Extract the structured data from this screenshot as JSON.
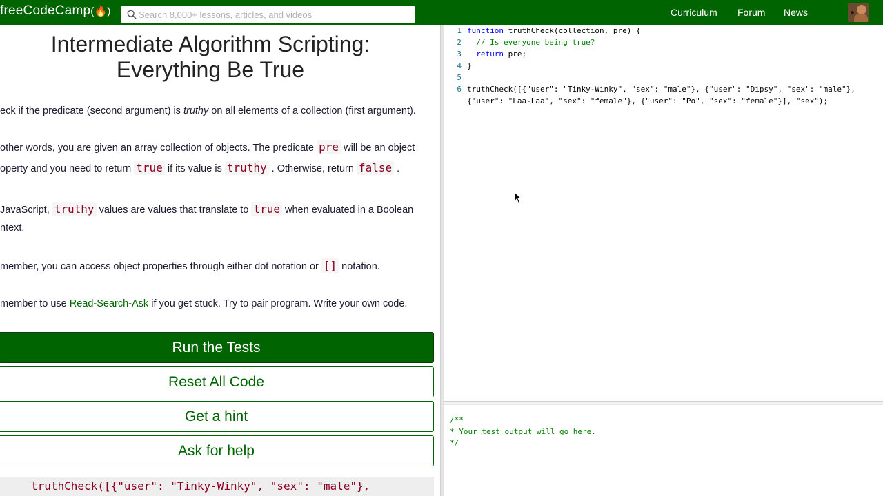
{
  "nav": {
    "logo_text": "freeCodeCamp",
    "logo_flame": "(🔥)",
    "search_placeholder": "Search 8,000+ lessons, articles, and videos",
    "links": [
      "Curriculum",
      "Forum",
      "News"
    ]
  },
  "challenge": {
    "title_line1": "Intermediate Algorithm Scripting:",
    "title_line2": "Everything Be True",
    "p1": {
      "a": "eck if the predicate (second argument) is ",
      "b": "truthy",
      "c": " on all elements of a collection (first argument)."
    },
    "p2": {
      "a": "other words, you are given an array collection of objects. The predicate ",
      "code1": "pre",
      "b": " will be an object",
      "c": "operty and you need to return ",
      "code2": "true",
      "d": " if its value is ",
      "code3": "truthy",
      "e": " . Otherwise, return ",
      "code4": "false",
      "f": " ."
    },
    "p3": {
      "a": "JavaScript, ",
      "code1": "truthy",
      "b": " values are values that translate to ",
      "code2": "true",
      "c": " when evaluated in a Boolean",
      "d": "ntext."
    },
    "p4": {
      "a": "member, you can access object properties through either dot notation or ",
      "code1": "[]",
      "b": " notation."
    },
    "p5": {
      "a": "member to use ",
      "link": "Read-Search-Ask",
      "b": " if you get stuck. Try to pair program. Write your own code."
    },
    "buttons": {
      "run": "Run the Tests",
      "reset": "Reset All Code",
      "hint": "Get a hint",
      "help": "Ask for help"
    },
    "test_call": "truthCheck([{\"user\": \"Tinky-Winky\", \"sex\": \"male\"},"
  },
  "editor": {
    "line_numbers": [
      "1",
      "2",
      "3",
      "4",
      "5",
      "6"
    ],
    "l1_kw": "function",
    "l1_rest": " truthCheck(collection, pre) {",
    "l2_comment": "  // Is everyone being true?",
    "l3_kw": "  return",
    "l3_rest": " pre;",
    "l4": "}",
    "l6a": "truthCheck([{\"user\": \"Tinky-Winky\", \"sex\": \"male\"}, {\"user\": \"Dipsy\", \"sex\": \"male\"},",
    "l6b": "{\"user\": \"Laa-Laa\", \"sex\": \"female\"}, {\"user\": \"Po\", \"sex\": \"female\"}], \"sex\");"
  },
  "output": {
    "text": "/**\n* Your test output will go here.\n*/"
  }
}
